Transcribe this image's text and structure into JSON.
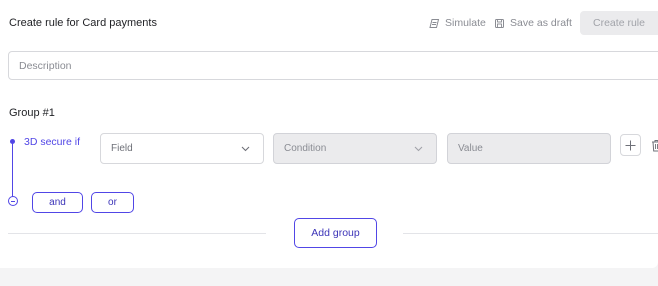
{
  "header": {
    "title": "Create rule for Card payments",
    "simulate_label": "Simulate",
    "save_draft_label": "Save as draft",
    "create_rule_label": "Create rule"
  },
  "description": {
    "placeholder": "Description",
    "value": ""
  },
  "group": {
    "title": "Group #1",
    "condition_label": "3D secure if",
    "field_label": "Field",
    "condition_placeholder": "Condition",
    "value_placeholder": "Value",
    "and_label": "and",
    "or_label": "or"
  },
  "footer": {
    "add_group_label": "Add group"
  },
  "colors": {
    "accent": "#5146e6",
    "border": "#d7d8dc",
    "disabled_bg": "#ebebed",
    "muted_text": "#8a8c93"
  },
  "icons": {
    "simulate": "simulate-icon",
    "save_draft": "save-icon",
    "chevron": "chevron-down-icon",
    "add": "plus-icon",
    "delete": "trash-icon"
  }
}
